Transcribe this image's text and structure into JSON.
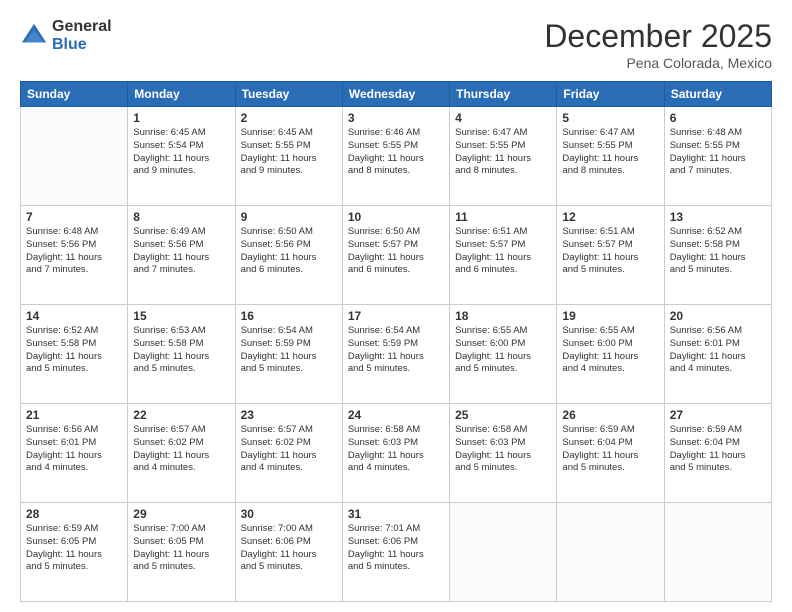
{
  "header": {
    "logo_general": "General",
    "logo_blue": "Blue",
    "month": "December 2025",
    "location": "Pena Colorada, Mexico"
  },
  "weekdays": [
    "Sunday",
    "Monday",
    "Tuesday",
    "Wednesday",
    "Thursday",
    "Friday",
    "Saturday"
  ],
  "weeks": [
    [
      {
        "date": "",
        "info": ""
      },
      {
        "date": "1",
        "info": "Sunrise: 6:45 AM\nSunset: 5:54 PM\nDaylight: 11 hours\nand 9 minutes."
      },
      {
        "date": "2",
        "info": "Sunrise: 6:45 AM\nSunset: 5:55 PM\nDaylight: 11 hours\nand 9 minutes."
      },
      {
        "date": "3",
        "info": "Sunrise: 6:46 AM\nSunset: 5:55 PM\nDaylight: 11 hours\nand 8 minutes."
      },
      {
        "date": "4",
        "info": "Sunrise: 6:47 AM\nSunset: 5:55 PM\nDaylight: 11 hours\nand 8 minutes."
      },
      {
        "date": "5",
        "info": "Sunrise: 6:47 AM\nSunset: 5:55 PM\nDaylight: 11 hours\nand 8 minutes."
      },
      {
        "date": "6",
        "info": "Sunrise: 6:48 AM\nSunset: 5:55 PM\nDaylight: 11 hours\nand 7 minutes."
      }
    ],
    [
      {
        "date": "7",
        "info": "Sunrise: 6:48 AM\nSunset: 5:56 PM\nDaylight: 11 hours\nand 7 minutes."
      },
      {
        "date": "8",
        "info": "Sunrise: 6:49 AM\nSunset: 5:56 PM\nDaylight: 11 hours\nand 7 minutes."
      },
      {
        "date": "9",
        "info": "Sunrise: 6:50 AM\nSunset: 5:56 PM\nDaylight: 11 hours\nand 6 minutes."
      },
      {
        "date": "10",
        "info": "Sunrise: 6:50 AM\nSunset: 5:57 PM\nDaylight: 11 hours\nand 6 minutes."
      },
      {
        "date": "11",
        "info": "Sunrise: 6:51 AM\nSunset: 5:57 PM\nDaylight: 11 hours\nand 6 minutes."
      },
      {
        "date": "12",
        "info": "Sunrise: 6:51 AM\nSunset: 5:57 PM\nDaylight: 11 hours\nand 5 minutes."
      },
      {
        "date": "13",
        "info": "Sunrise: 6:52 AM\nSunset: 5:58 PM\nDaylight: 11 hours\nand 5 minutes."
      }
    ],
    [
      {
        "date": "14",
        "info": "Sunrise: 6:52 AM\nSunset: 5:58 PM\nDaylight: 11 hours\nand 5 minutes."
      },
      {
        "date": "15",
        "info": "Sunrise: 6:53 AM\nSunset: 5:58 PM\nDaylight: 11 hours\nand 5 minutes."
      },
      {
        "date": "16",
        "info": "Sunrise: 6:54 AM\nSunset: 5:59 PM\nDaylight: 11 hours\nand 5 minutes."
      },
      {
        "date": "17",
        "info": "Sunrise: 6:54 AM\nSunset: 5:59 PM\nDaylight: 11 hours\nand 5 minutes."
      },
      {
        "date": "18",
        "info": "Sunrise: 6:55 AM\nSunset: 6:00 PM\nDaylight: 11 hours\nand 5 minutes."
      },
      {
        "date": "19",
        "info": "Sunrise: 6:55 AM\nSunset: 6:00 PM\nDaylight: 11 hours\nand 4 minutes."
      },
      {
        "date": "20",
        "info": "Sunrise: 6:56 AM\nSunset: 6:01 PM\nDaylight: 11 hours\nand 4 minutes."
      }
    ],
    [
      {
        "date": "21",
        "info": "Sunrise: 6:56 AM\nSunset: 6:01 PM\nDaylight: 11 hours\nand 4 minutes."
      },
      {
        "date": "22",
        "info": "Sunrise: 6:57 AM\nSunset: 6:02 PM\nDaylight: 11 hours\nand 4 minutes."
      },
      {
        "date": "23",
        "info": "Sunrise: 6:57 AM\nSunset: 6:02 PM\nDaylight: 11 hours\nand 4 minutes."
      },
      {
        "date": "24",
        "info": "Sunrise: 6:58 AM\nSunset: 6:03 PM\nDaylight: 11 hours\nand 4 minutes."
      },
      {
        "date": "25",
        "info": "Sunrise: 6:58 AM\nSunset: 6:03 PM\nDaylight: 11 hours\nand 5 minutes."
      },
      {
        "date": "26",
        "info": "Sunrise: 6:59 AM\nSunset: 6:04 PM\nDaylight: 11 hours\nand 5 minutes."
      },
      {
        "date": "27",
        "info": "Sunrise: 6:59 AM\nSunset: 6:04 PM\nDaylight: 11 hours\nand 5 minutes."
      }
    ],
    [
      {
        "date": "28",
        "info": "Sunrise: 6:59 AM\nSunset: 6:05 PM\nDaylight: 11 hours\nand 5 minutes."
      },
      {
        "date": "29",
        "info": "Sunrise: 7:00 AM\nSunset: 6:05 PM\nDaylight: 11 hours\nand 5 minutes."
      },
      {
        "date": "30",
        "info": "Sunrise: 7:00 AM\nSunset: 6:06 PM\nDaylight: 11 hours\nand 5 minutes."
      },
      {
        "date": "31",
        "info": "Sunrise: 7:01 AM\nSunset: 6:06 PM\nDaylight: 11 hours\nand 5 minutes."
      },
      {
        "date": "",
        "info": ""
      },
      {
        "date": "",
        "info": ""
      },
      {
        "date": "",
        "info": ""
      }
    ]
  ]
}
